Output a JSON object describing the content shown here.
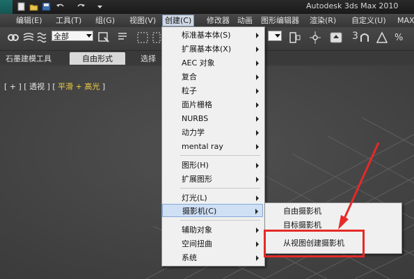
{
  "window": {
    "title": "Autodesk 3ds Max  2010"
  },
  "menubar": {
    "items": [
      {
        "label": "编辑(E)"
      },
      {
        "label": "工具(T)"
      },
      {
        "label": "组(G)"
      },
      {
        "label": "视图(V)"
      },
      {
        "label": "创建(C)"
      },
      {
        "label": "修改器"
      },
      {
        "label": "动画"
      },
      {
        "label": "图形编辑器"
      },
      {
        "label": "渲染(R)"
      },
      {
        "label": "自定义(U)"
      },
      {
        "label": "MAX"
      }
    ]
  },
  "toolbar": {
    "selection_filter": "全部",
    "numbers": "3"
  },
  "ribbon": {
    "tabs": [
      {
        "label": "石墨建模工具"
      },
      {
        "label": "自由形式"
      },
      {
        "label": "选择"
      }
    ]
  },
  "viewport": {
    "label_prefix": "[ + ] [ 透视 ] [ ",
    "label_mode": "平滑 + 高光",
    "label_suffix": " ]"
  },
  "create_menu": {
    "items": [
      {
        "label": "标准基本体(S)"
      },
      {
        "label": "扩展基本体(X)"
      },
      {
        "label": "AEC 对象"
      },
      {
        "label": "复合"
      },
      {
        "label": "粒子"
      },
      {
        "label": "面片栅格"
      },
      {
        "label": "NURBS"
      },
      {
        "label": "动力学"
      },
      {
        "label": "mental ray"
      },
      {
        "label": "图形(H)"
      },
      {
        "label": "扩展图形"
      },
      {
        "label": "灯光(L)"
      },
      {
        "label": "摄影机(C)"
      },
      {
        "label": "辅助对象"
      },
      {
        "label": "空间扭曲"
      },
      {
        "label": "系统"
      }
    ]
  },
  "camera_submenu": {
    "items": [
      {
        "label": "自由摄影机"
      },
      {
        "label": "目标摄影机"
      },
      {
        "label": "从视图创建摄影机"
      }
    ]
  },
  "colors": {
    "highlight_box": "#e52a28",
    "arrow": "#e52a28",
    "viewport_bg": "#4a4a4a"
  }
}
